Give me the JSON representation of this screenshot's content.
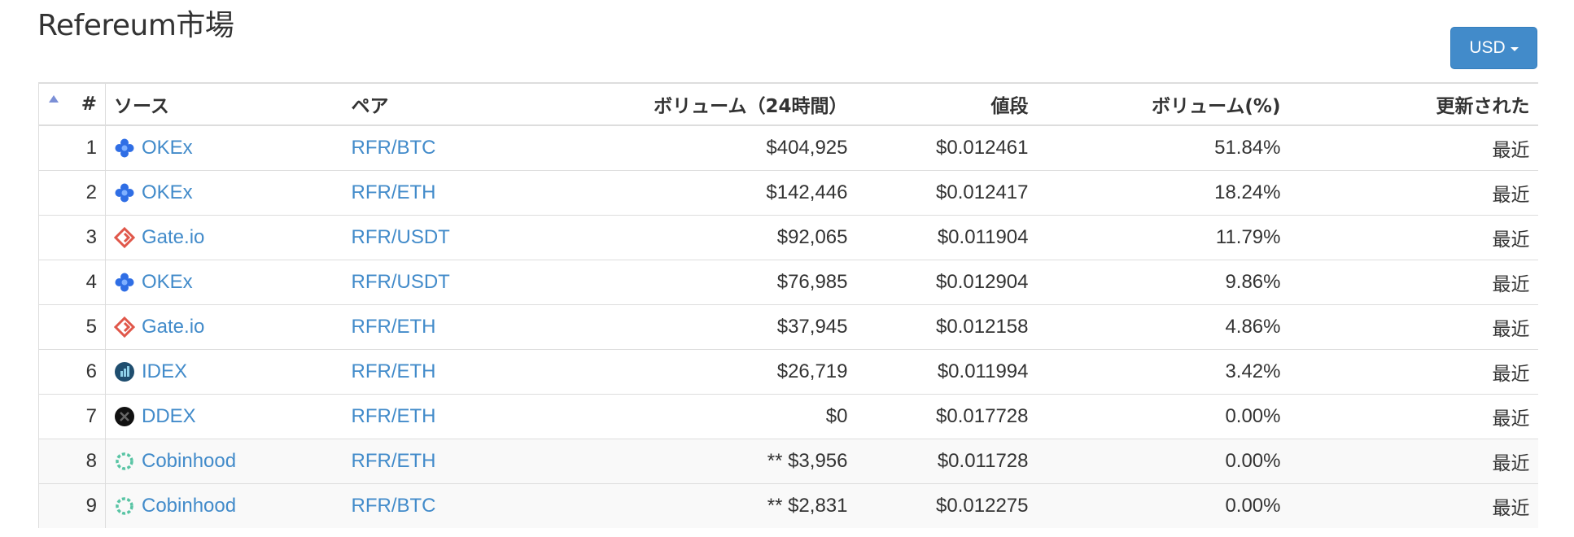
{
  "page": {
    "title": "Refereum市場"
  },
  "currency_selector": {
    "label": "USD"
  },
  "table": {
    "headers": {
      "rank": "#",
      "source": "ソース",
      "pair": "ペア",
      "volume_24h": "ボリューム（24時間）",
      "price": "値段",
      "volume_pct": "ボリューム(%)",
      "updated": "更新された"
    },
    "rows": [
      {
        "rank": "1",
        "source": "OKEx",
        "source_icon": "okex-icon",
        "pair": "RFR/BTC",
        "volume": "$404,925",
        "price": "$0.012461",
        "volume_pct": "51.84%",
        "updated": "最近"
      },
      {
        "rank": "2",
        "source": "OKEx",
        "source_icon": "okex-icon",
        "pair": "RFR/ETH",
        "volume": "$142,446",
        "price": "$0.012417",
        "volume_pct": "18.24%",
        "updated": "最近"
      },
      {
        "rank": "3",
        "source": "Gate.io",
        "source_icon": "gateio-icon",
        "pair": "RFR/USDT",
        "volume": "$92,065",
        "price": "$0.011904",
        "volume_pct": "11.79%",
        "updated": "最近"
      },
      {
        "rank": "4",
        "source": "OKEx",
        "source_icon": "okex-icon",
        "pair": "RFR/USDT",
        "volume": "$76,985",
        "price": "$0.012904",
        "volume_pct": "9.86%",
        "updated": "最近"
      },
      {
        "rank": "5",
        "source": "Gate.io",
        "source_icon": "gateio-icon",
        "pair": "RFR/ETH",
        "volume": "$37,945",
        "price": "$0.012158",
        "volume_pct": "4.86%",
        "updated": "最近"
      },
      {
        "rank": "6",
        "source": "IDEX",
        "source_icon": "idex-icon",
        "pair": "RFR/ETH",
        "volume": "$26,719",
        "price": "$0.011994",
        "volume_pct": "3.42%",
        "updated": "最近"
      },
      {
        "rank": "7",
        "source": "DDEX",
        "source_icon": "ddex-icon",
        "pair": "RFR/ETH",
        "volume": "$0",
        "price": "$0.017728",
        "volume_pct": "0.00%",
        "updated": "最近"
      },
      {
        "rank": "8",
        "source": "Cobinhood",
        "source_icon": "cobinhood-icon",
        "pair": "RFR/ETH",
        "volume": "** $3,956",
        "price": "$0.011728",
        "volume_pct": "0.00%",
        "updated": "最近"
      },
      {
        "rank": "9",
        "source": "Cobinhood",
        "source_icon": "cobinhood-icon",
        "pair": "RFR/BTC",
        "volume": "** $2,831",
        "price": "$0.012275",
        "volume_pct": "0.00%",
        "updated": "最近"
      }
    ]
  },
  "colors": {
    "link": "#428bca",
    "button": "#428bca",
    "okex": "#2f6ee5",
    "gateio": "#e0574a",
    "idex": "#1f4e6f",
    "ddex": "#111111",
    "cobinhood": "#58c4a4"
  }
}
